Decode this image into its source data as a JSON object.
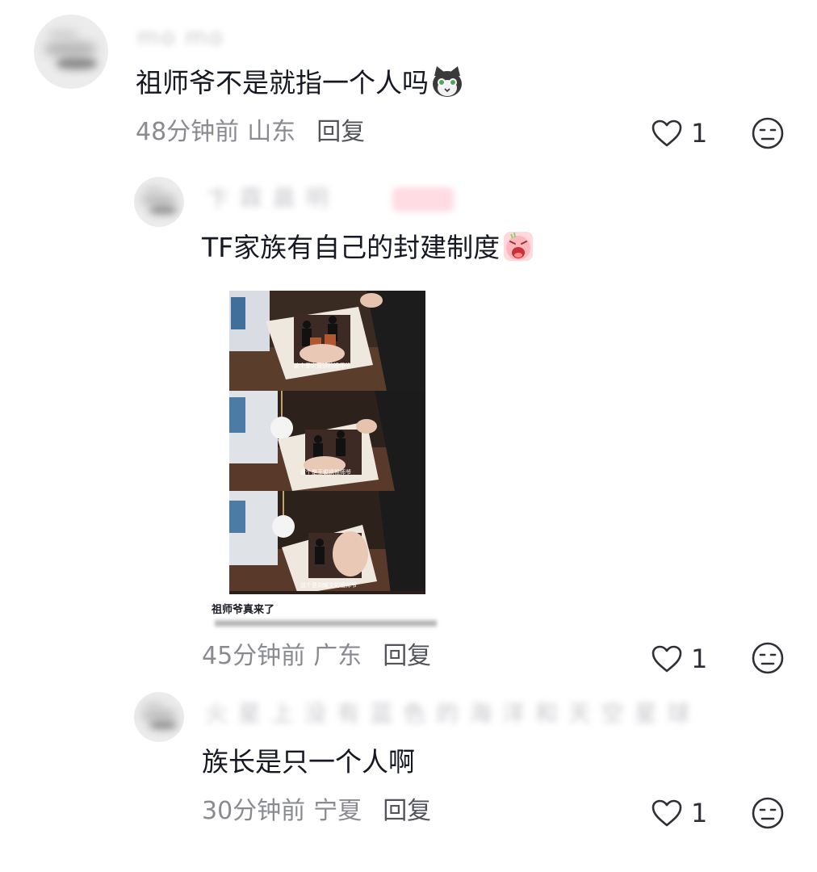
{
  "colors": {
    "text": "#161823",
    "meta": "#8a8b91",
    "reply": "#53545a",
    "icon": "#2f3036"
  },
  "comments": [
    {
      "text": "祖师爷不是就指一个人吗",
      "emoji": "cat-face-emoji",
      "time": "48分钟前",
      "location": "山东",
      "reply_label": "回复",
      "likes": "1"
    },
    {
      "text": "TF家族有自己的封建制度",
      "emoji": "crying-face-emoji",
      "image": {
        "caption": "祖师爷真来了",
        "frames": [
          {
            "subtitle": "这个是宋亚轩的祖师爷"
          },
          {
            "subtitle": "这个是王俊凯祖师爷"
          },
          {
            "subtitle": "这个是刘耀文的祖师爷"
          }
        ]
      },
      "time": "45分钟前",
      "location": "广东",
      "reply_label": "回复",
      "likes": "1"
    },
    {
      "text": "族长是只一个人啊",
      "time": "30分钟前",
      "location": "宁夏",
      "reply_label": "回复",
      "likes": "1"
    }
  ]
}
